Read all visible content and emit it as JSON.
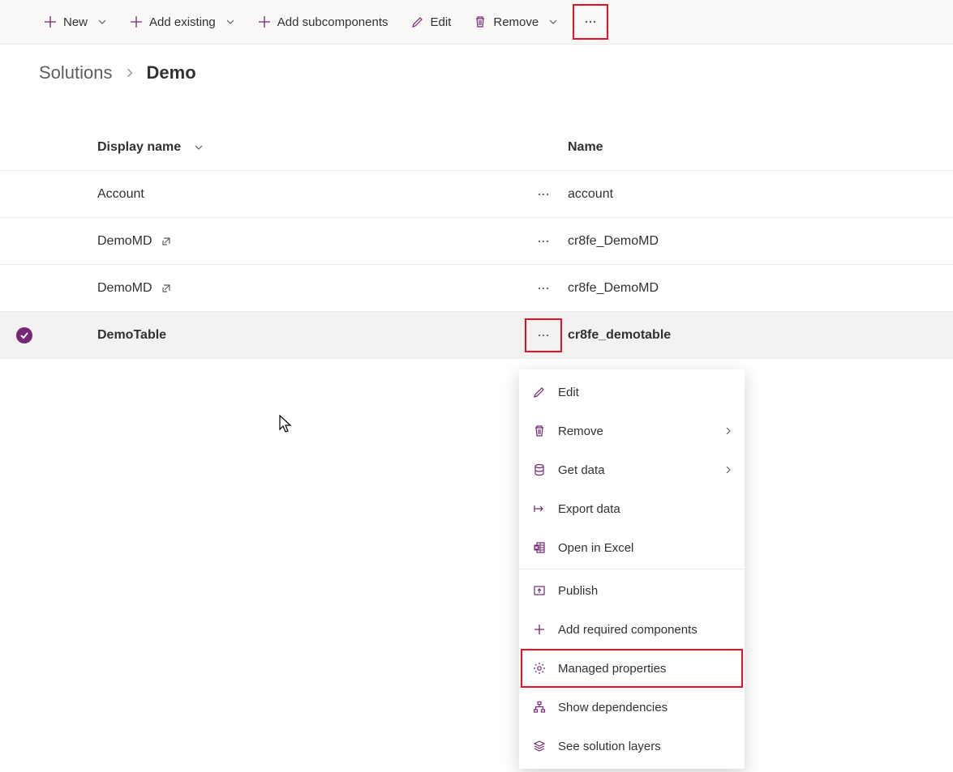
{
  "toolbar": {
    "new_label": "New",
    "add_existing_label": "Add existing",
    "add_subcomponents_label": "Add subcomponents",
    "edit_label": "Edit",
    "remove_label": "Remove"
  },
  "breadcrumb": {
    "root": "Solutions",
    "current": "Demo"
  },
  "columns": {
    "display_name": "Display name",
    "name": "Name"
  },
  "rows": [
    {
      "display": "Account",
      "external": false,
      "name": "account"
    },
    {
      "display": "DemoMD",
      "external": true,
      "name": "cr8fe_DemoMD"
    },
    {
      "display": "DemoMD",
      "external": true,
      "name": "cr8fe_DemoMD"
    },
    {
      "display": "DemoTable",
      "external": false,
      "name": "cr8fe_demotable",
      "selected": true
    }
  ],
  "menu": {
    "edit": "Edit",
    "remove": "Remove",
    "get_data": "Get data",
    "export_data": "Export data",
    "open_excel": "Open in Excel",
    "publish": "Publish",
    "add_required": "Add required components",
    "managed_props": "Managed properties",
    "show_deps": "Show dependencies",
    "solution_layers": "See solution layers"
  }
}
